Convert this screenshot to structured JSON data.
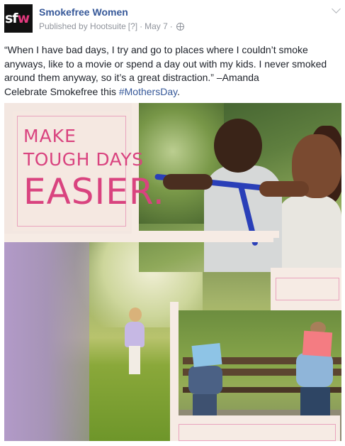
{
  "page": {
    "avatar_letters_main": "sf",
    "avatar_letter_accent": "w",
    "name": "Smokefree Women"
  },
  "meta": {
    "published_by": "Published by Hootsuite",
    "help": "[?]",
    "separator": "·",
    "date": "May 7",
    "separator2": "·",
    "audience_icon": "globe-icon"
  },
  "post": {
    "body": "“When I have bad days, I try and go to places where I couldn’t smoke anyways, like to a movie or spend a day out with my kids. I never smoked around them anyway, so it’s a great distraction.” –Amanda",
    "celebrate_prefix": "Celebrate Smokefree this ",
    "hashtag": "#MothersDay",
    "celebrate_suffix": "."
  },
  "image": {
    "headline_line1": "MAKE",
    "headline_line2": "TOUGH DAYS",
    "headline_line3": "EASIER."
  },
  "colors": {
    "link": "#365899",
    "accent_pink": "#d9437f",
    "meta_gray": "#90949c"
  }
}
